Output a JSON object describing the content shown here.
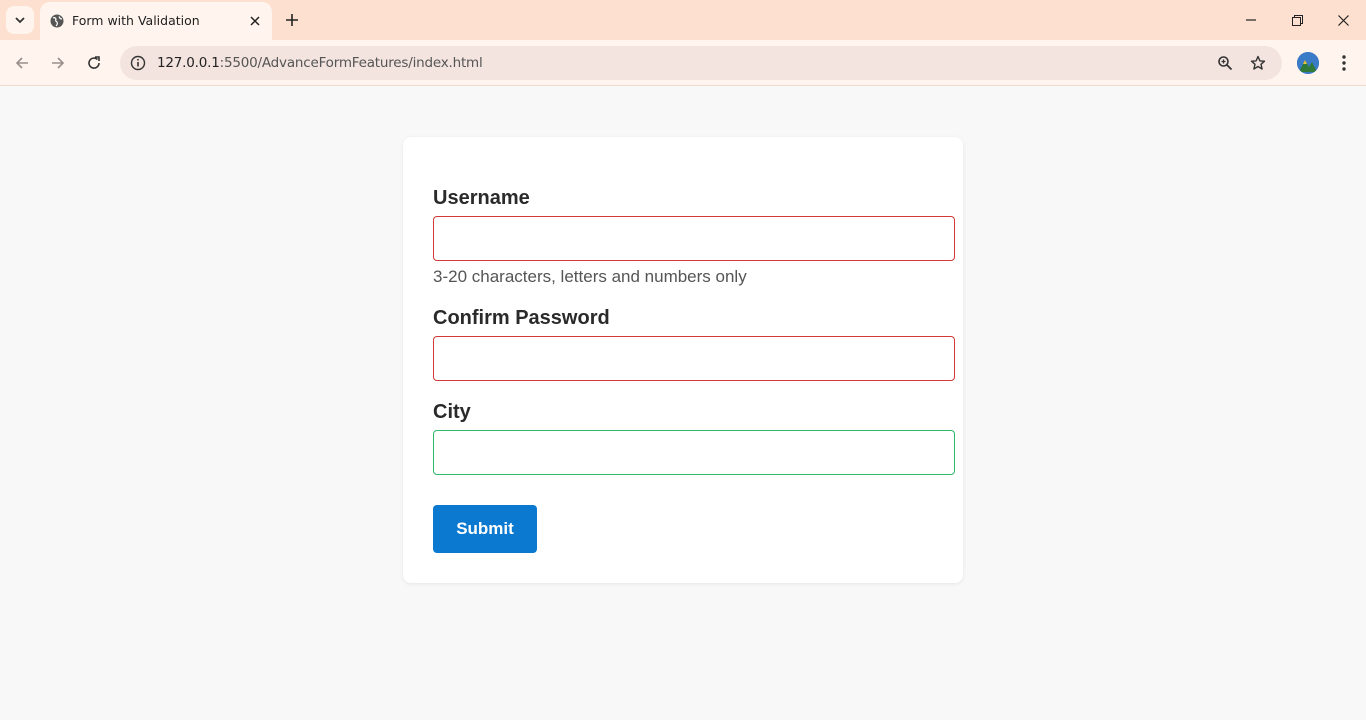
{
  "browser": {
    "tab_title": "Form with Validation",
    "url_host": "127.0.0.1",
    "url_rest": ":5500/AdvanceFormFeatures/index.html"
  },
  "form": {
    "username_label": "Username",
    "username_value": "",
    "username_hint": "3-20 characters, letters and numbers only",
    "confirm_password_label": "Confirm Password",
    "confirm_password_value": "",
    "city_label": "City",
    "city_value": "",
    "submit_label": "Submit"
  },
  "colors": {
    "invalid_border": "#d23a3a",
    "valid_border": "#2dba6a",
    "submit_bg": "#0b79d0",
    "tabbar_bg": "#fde0cf"
  }
}
